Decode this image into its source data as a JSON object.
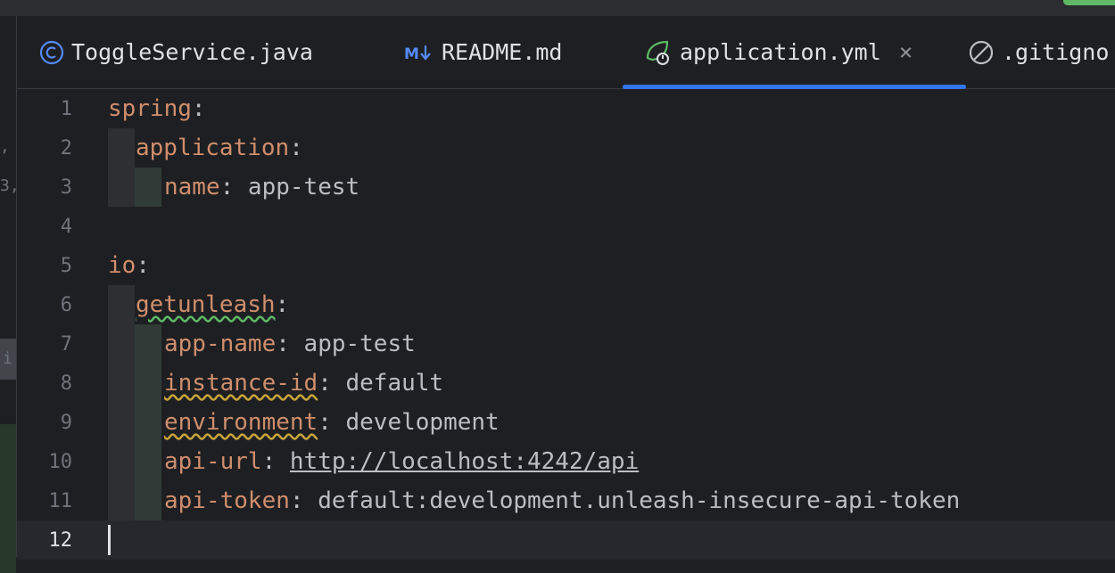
{
  "tabs": [
    {
      "label": "ToggleService.java",
      "icon": "java-class-icon",
      "active": false
    },
    {
      "label": "README.md",
      "icon": "markdown-icon",
      "active": false
    },
    {
      "label": "application.yml",
      "icon": "spring-config-icon",
      "active": true
    },
    {
      "label": ".gitigno",
      "icon": "ignore-file-icon",
      "active": false
    }
  ],
  "close_label": "×",
  "left_strip": [
    ",",
    "3,",
    "i"
  ],
  "lines": [
    {
      "num": "1",
      "key": "spring",
      "sep": ":",
      "val": ""
    },
    {
      "num": "2",
      "key": "application",
      "sep": ":",
      "val": ""
    },
    {
      "num": "3",
      "key": "name",
      "sep": ":",
      "val": " app-test"
    },
    {
      "num": "4",
      "key": "",
      "sep": "",
      "val": ""
    },
    {
      "num": "5",
      "key": "io",
      "sep": ":",
      "val": ""
    },
    {
      "num": "6",
      "key": "getunleash",
      "sep": ":",
      "val": ""
    },
    {
      "num": "7",
      "key": "app-name",
      "sep": ":",
      "val": " app-test"
    },
    {
      "num": "8",
      "key": "instance-id",
      "sep": ":",
      "val": " default"
    },
    {
      "num": "9",
      "key": "environment",
      "sep": ":",
      "val": " development"
    },
    {
      "num": "10",
      "key": "api-url",
      "sep": ":",
      "val": "http://localhost:4242/api"
    },
    {
      "num": "11",
      "key": "api-token",
      "sep": ":",
      "val": " default:development.unleash-insecure-api-token"
    },
    {
      "num": "12",
      "key": "",
      "sep": "",
      "val": ""
    }
  ],
  "colors": {
    "key": "#cf8e6d",
    "text": "#bcbec4",
    "accent": "#3574f0",
    "background": "#1e1f22"
  }
}
